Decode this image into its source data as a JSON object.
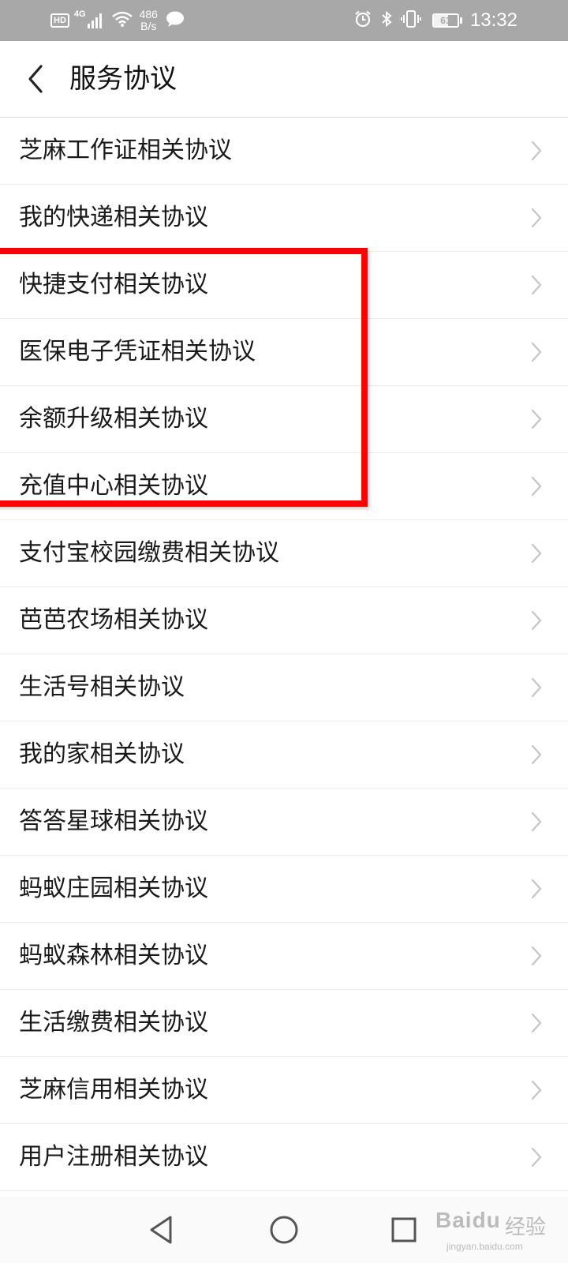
{
  "status_bar": {
    "hd": "HD",
    "network": "4G",
    "speed_value": "486",
    "speed_unit": "B/s",
    "battery_percent": "61",
    "battery_level": 0.61,
    "time": "13:32"
  },
  "header": {
    "title": "服务协议"
  },
  "agreements": [
    "芝麻工作证相关协议",
    "我的快递相关协议",
    "快捷支付相关协议",
    "医保电子凭证相关协议",
    "余额升级相关协议",
    "充值中心相关协议",
    "支付宝校园缴费相关协议",
    "芭芭农场相关协议",
    "生活号相关协议",
    "我的家相关协议",
    "答答星球相关协议",
    "蚂蚁庄园相关协议",
    "蚂蚁森林相关协议",
    "生活缴费相关协议",
    "芝麻信用相关协议",
    "用户注册相关协议"
  ],
  "watermark": {
    "main": "Baidu",
    "cn": "经验",
    "sub": "jingyan.baidu.com"
  },
  "colors": {
    "status_bar_bg": "#a8a8a8",
    "highlight": "#ff0000",
    "chevron": "#c4c4c4"
  },
  "icons": {
    "back": "chevron-left-icon",
    "row_arrow": "chevron-right-icon",
    "nav_back": "triangle-back-icon",
    "nav_home": "circle-home-icon",
    "nav_recents": "square-recents-icon"
  }
}
